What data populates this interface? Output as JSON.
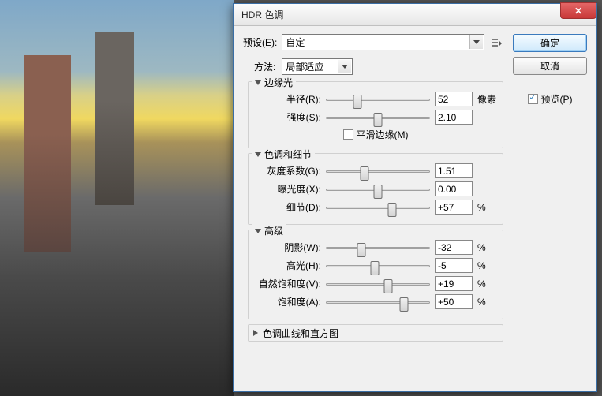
{
  "title": "HDR 色调",
  "preset": {
    "label": "预设(E):",
    "value": "自定"
  },
  "method": {
    "label": "方法:",
    "value": "局部适应"
  },
  "buttons": {
    "ok": "确定",
    "cancel": "取消"
  },
  "preview": {
    "label": "预览(P)",
    "checked": true
  },
  "groups": {
    "edge": {
      "title": "边缘光",
      "radius": {
        "label": "半径(R):",
        "value": "52",
        "unit": "像素",
        "pos": 30
      },
      "strength": {
        "label": "强度(S):",
        "value": "2.10",
        "unit": "",
        "pos": 50
      },
      "smooth": {
        "label": "平滑边缘(M)",
        "checked": false
      }
    },
    "tone": {
      "title": "色调和细节",
      "gamma": {
        "label": "灰度系数(G):",
        "value": "1.51",
        "unit": "",
        "pos": 37
      },
      "exposure": {
        "label": "曝光度(X):",
        "value": "0.00",
        "unit": "",
        "pos": 50
      },
      "detail": {
        "label": "细节(D):",
        "value": "+57",
        "unit": "%",
        "pos": 64
      }
    },
    "advanced": {
      "title": "高级",
      "shadow": {
        "label": "阴影(W):",
        "value": "-32",
        "unit": "%",
        "pos": 34
      },
      "highlight": {
        "label": "高光(H):",
        "value": "-5",
        "unit": "%",
        "pos": 47
      },
      "vibrance": {
        "label": "自然饱和度(V):",
        "value": "+19",
        "unit": "%",
        "pos": 60
      },
      "saturation": {
        "label": "饱和度(A):",
        "value": "+50",
        "unit": "%",
        "pos": 75
      }
    },
    "curve": {
      "title": "色调曲线和直方图"
    }
  }
}
